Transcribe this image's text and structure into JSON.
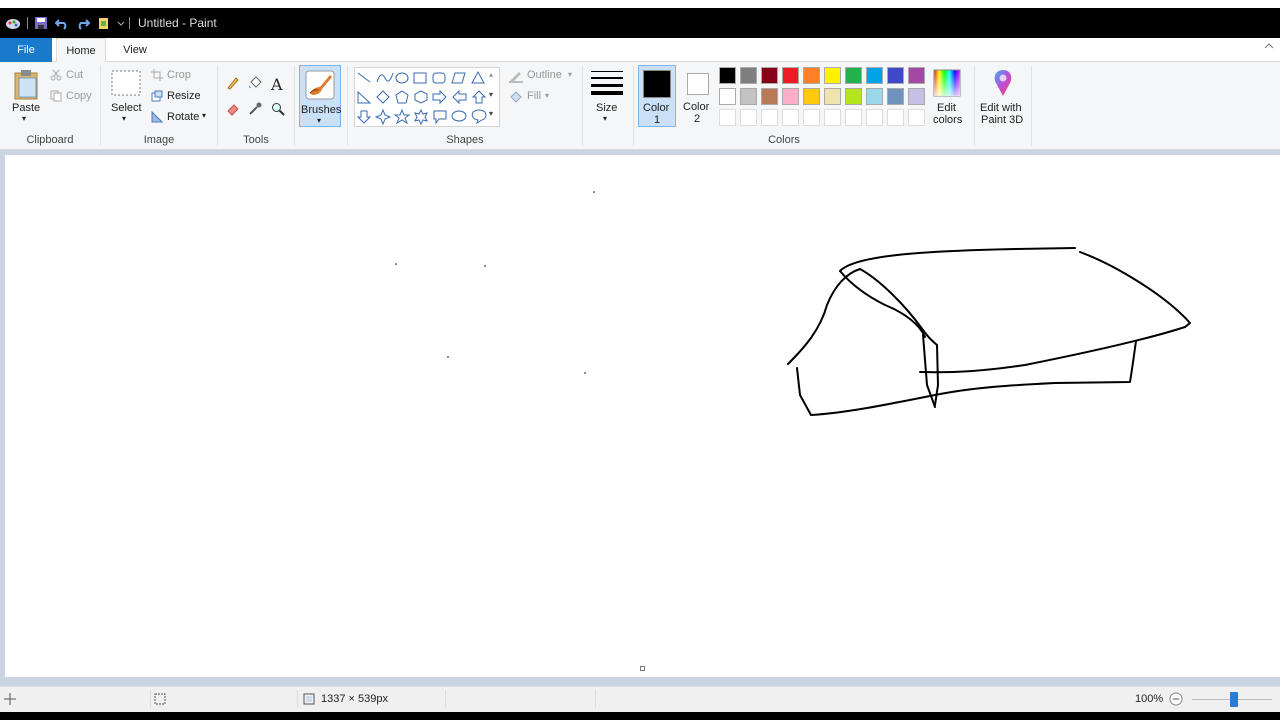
{
  "window": {
    "title": "Untitled - Paint"
  },
  "tabs": {
    "file": "File",
    "home": "Home",
    "view": "View"
  },
  "clipboard": {
    "paste": "Paste",
    "cut": "Cut",
    "copy": "Copy",
    "group": "Clipboard"
  },
  "image": {
    "select": "Select",
    "crop": "Crop",
    "resize": "Resize",
    "rotate": "Rotate",
    "group": "Image"
  },
  "tools": {
    "group": "Tools"
  },
  "brushes": {
    "label": "Brushes"
  },
  "shapes": {
    "outline": "Outline",
    "fill": "Fill",
    "group": "Shapes"
  },
  "size": {
    "label": "Size"
  },
  "colors": {
    "color1_label": "Color",
    "color1_num": "1",
    "color2_label": "Color",
    "color2_num": "2",
    "group": "Colors",
    "edit_line1": "Edit",
    "edit_line2": "colors",
    "paint3d_line1": "Edit with",
    "paint3d_line2": "Paint 3D",
    "color1_value": "#000000",
    "color2_value": "#ffffff",
    "palette_row1": [
      "#000000",
      "#7f7f7f",
      "#880015",
      "#ed1c24",
      "#ff7f27",
      "#fff200",
      "#22b14c",
      "#00a2e8",
      "#3f48cc",
      "#a349a4"
    ],
    "palette_row2": [
      "#ffffff",
      "#c3c3c3",
      "#b97a57",
      "#ffaec9",
      "#ffc90e",
      "#efe4b0",
      "#b5e61d",
      "#99d9ea",
      "#7092be",
      "#c8bfe7"
    ]
  },
  "status": {
    "canvas_size": "1337 × 539px",
    "zoom": "100%"
  }
}
